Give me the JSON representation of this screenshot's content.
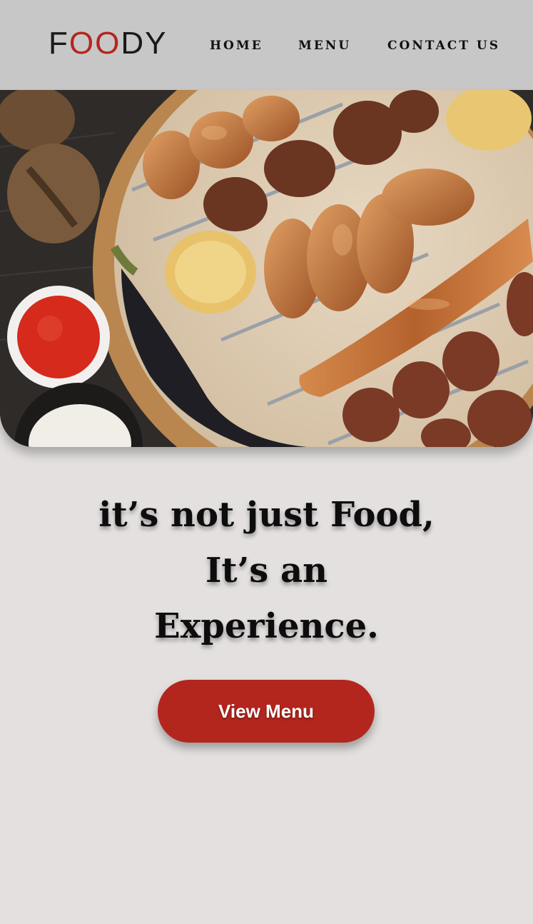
{
  "header": {
    "logo": {
      "part1": "F",
      "part2": "OO",
      "part3": "DY"
    },
    "nav": [
      {
        "label": "HOME"
      },
      {
        "label": "MENU"
      },
      {
        "label": "CONTACT US"
      }
    ]
  },
  "hero": {
    "image_subject": "grilled meat platter"
  },
  "main": {
    "headline_lines": [
      "it’s not just Food,",
      "It’s an",
      "Experience."
    ],
    "cta_label": "View Menu"
  },
  "colors": {
    "accent": "#b3261e",
    "header_bg": "#c8c7c7",
    "page_bg": "#e4e0e0",
    "text": "#0d0d0d"
  }
}
